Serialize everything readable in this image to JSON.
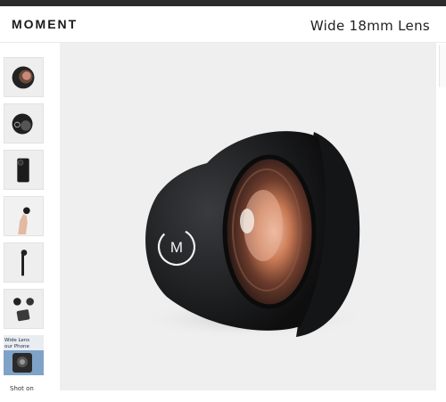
{
  "header": {
    "logo": "MOMENT",
    "product_title": "Wide 18mm Lens"
  },
  "thumbnails": [
    {
      "label": "Lens front view",
      "icon": "lens-icon"
    },
    {
      "label": "Lens side view",
      "icon": "lens-icon"
    },
    {
      "label": "Lens on phone case",
      "icon": "phone-case-icon"
    },
    {
      "label": "Lens in hand",
      "icon": "hand-icon"
    },
    {
      "label": "Lens on mount",
      "icon": "mount-icon"
    },
    {
      "label": "Lens with accessories",
      "icon": "accessories-icon"
    },
    {
      "label": "Video thumbnail",
      "icon": "video-icon",
      "text_lines": [
        "Wide Lens",
        "our Phone"
      ]
    }
  ],
  "thumbnail_caption": "Shot on",
  "main_image": {
    "alt": "Moment Wide 18mm Lens",
    "badge_letter": "M"
  },
  "colors": {
    "top_bar": "#2b2b2b",
    "image_bg": "#efefef",
    "lens_body": "#1e1f21"
  }
}
